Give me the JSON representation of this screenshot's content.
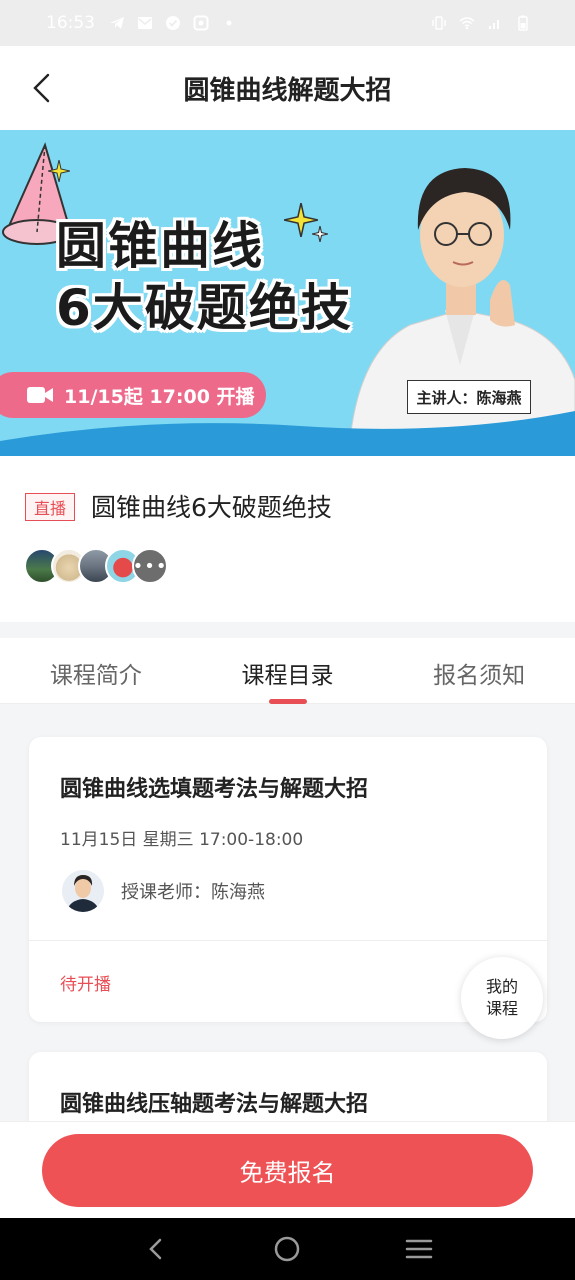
{
  "status_bar": {
    "time": "16:53"
  },
  "nav": {
    "title": "圆锥曲线解题大招"
  },
  "banner": {
    "title_line1": "圆锥曲线",
    "title_line2": "6大破题绝技",
    "schedule": "11/15起 17:00 开播",
    "speaker": "主讲人：陈海燕"
  },
  "course": {
    "badge": "直播",
    "name": "圆锥曲线6大破题绝技",
    "more_avatars": "•••"
  },
  "tabs": [
    {
      "label": "课程简介"
    },
    {
      "label": "课程目录"
    },
    {
      "label": "报名须知"
    }
  ],
  "active_tab": "课程目录",
  "lessons": [
    {
      "title": "圆锥曲线选填题考法与解题大招",
      "time": "11月15日 星期三 17:00-18:00",
      "teacher": "授课老师：陈海燕",
      "status": "待开播"
    },
    {
      "title": "圆锥曲线压轴题考法与解题大招"
    }
  ],
  "floating": {
    "line1": "我的",
    "line2": "课程"
  },
  "signup_button": "免费报名",
  "colors": {
    "accent": "#ee5255",
    "banner_bg": "#7fd9f3",
    "pill": "#ee6a8b"
  }
}
